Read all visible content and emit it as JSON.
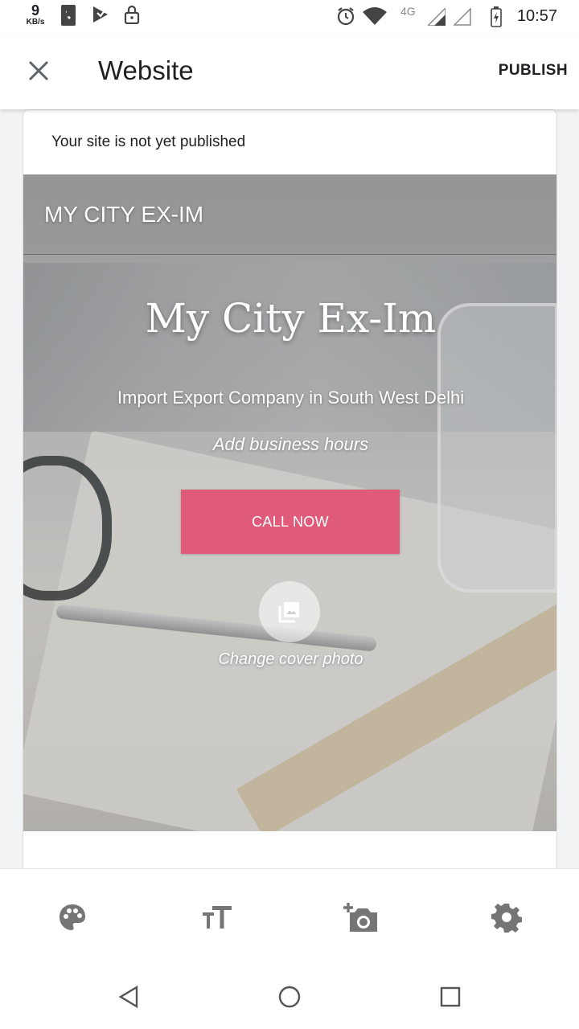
{
  "status_bar": {
    "speed_value": "9",
    "speed_unit": "KB/s",
    "network": "4G",
    "time": "10:57",
    "icons": [
      "phone-icon",
      "play-store-icon",
      "lock-icon",
      "alarm-icon",
      "wifi-icon",
      "signal-icon",
      "signal-empty-icon",
      "battery-charging-icon"
    ]
  },
  "app_bar": {
    "title": "Website",
    "publish_label": "PUBLISH",
    "close_icon": "close-icon"
  },
  "preview": {
    "notice": "Your site is not yet published",
    "site_name": "MY CITY EX-IM",
    "hero_title": "My City Ex-Im",
    "hero_subtitle": "Import Export Company in South West Delhi",
    "business_hours_placeholder": "Add business hours",
    "call_label": "CALL NOW",
    "cover_photo_label": "Change cover photo",
    "cover_icon": "photo-library-icon"
  },
  "toolbar": {
    "items": [
      {
        "name": "palette-icon"
      },
      {
        "name": "text-size-icon"
      },
      {
        "name": "add-photo-icon"
      },
      {
        "name": "settings-icon"
      }
    ]
  },
  "nav_bar": {
    "items": [
      "back-icon",
      "home-icon",
      "recents-icon"
    ]
  },
  "colors": {
    "accent_button": "#e05a7a",
    "icon_gray": "#757575"
  }
}
